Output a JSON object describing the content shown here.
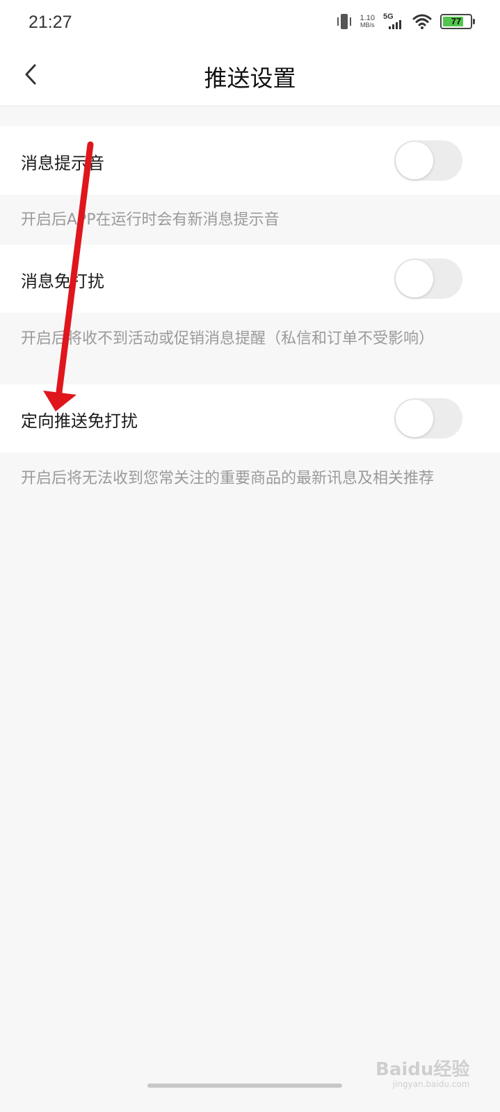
{
  "status_bar": {
    "time": "21:27",
    "net_speed_value": "1.10",
    "net_speed_unit": "MB/s",
    "signal_label": "5G",
    "battery_level": "77",
    "battery_color": "#52c54d"
  },
  "header": {
    "title": "推送设置",
    "back_icon": "chevron-left-icon"
  },
  "settings": [
    {
      "label": "消息提示音",
      "enabled": false,
      "description": "开启后APP在运行时会有新消息提示音"
    },
    {
      "label": "消息免打扰",
      "enabled": false,
      "description": "开启后将收不到活动或促销消息提醒（私信和订单不受影响）"
    },
    {
      "label": "定向推送免打扰",
      "enabled": false,
      "description": "开启后将无法收到您常关注的重要商品的最新讯息及相关推荐"
    }
  ],
  "annotation": {
    "arrow_color": "#e0161d"
  },
  "watermark": {
    "text": "Baidu经验",
    "subtext": "jingyan.baidu.com"
  }
}
